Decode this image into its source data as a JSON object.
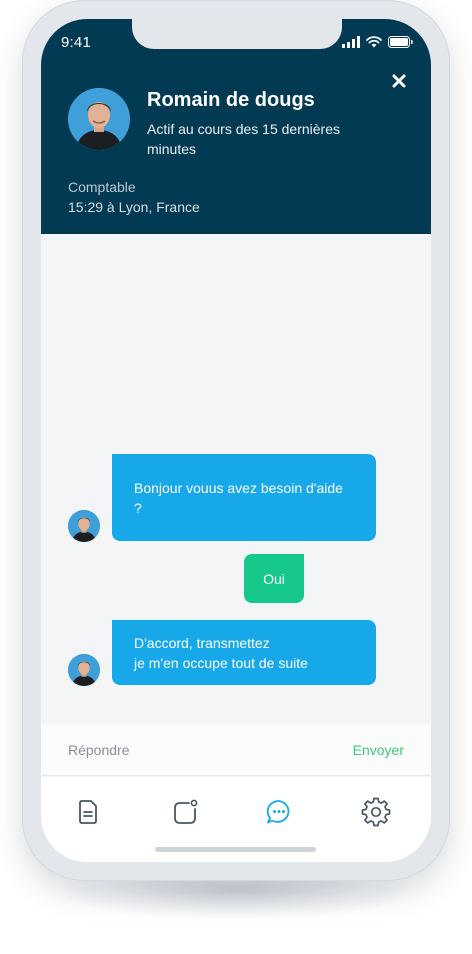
{
  "status_bar": {
    "time": "9:41"
  },
  "header": {
    "name": "Romain de dougs",
    "activity": "Actif au cours des 15 dernières minutes",
    "role": "Comptable",
    "location": "15:29 à Lyon, France",
    "bg_color": "#033a53",
    "close_icon": "close-icon"
  },
  "chat": {
    "messages": [
      {
        "from": "agent",
        "text": "Bonjour vouus avez besoin d'aide ?",
        "color": "#17a8ea"
      },
      {
        "from": "user",
        "text": "Oui",
        "color": "#16c889"
      },
      {
        "from": "agent",
        "text": "D'accord, transmettez\nje m'en occupe tout de suite",
        "color": "#17a8ea"
      }
    ]
  },
  "composer": {
    "placeholder": "Répondre",
    "send_label": "Envoyer",
    "send_color": "#3cc97a"
  },
  "tabbar": {
    "items": [
      {
        "icon": "document-icon",
        "active": false
      },
      {
        "icon": "notification-square-icon",
        "active": false
      },
      {
        "icon": "chat-bubble-icon",
        "active": true
      },
      {
        "icon": "gear-icon",
        "active": false
      }
    ],
    "active_color": "#17a8ea",
    "inactive_color": "#4a5560"
  }
}
